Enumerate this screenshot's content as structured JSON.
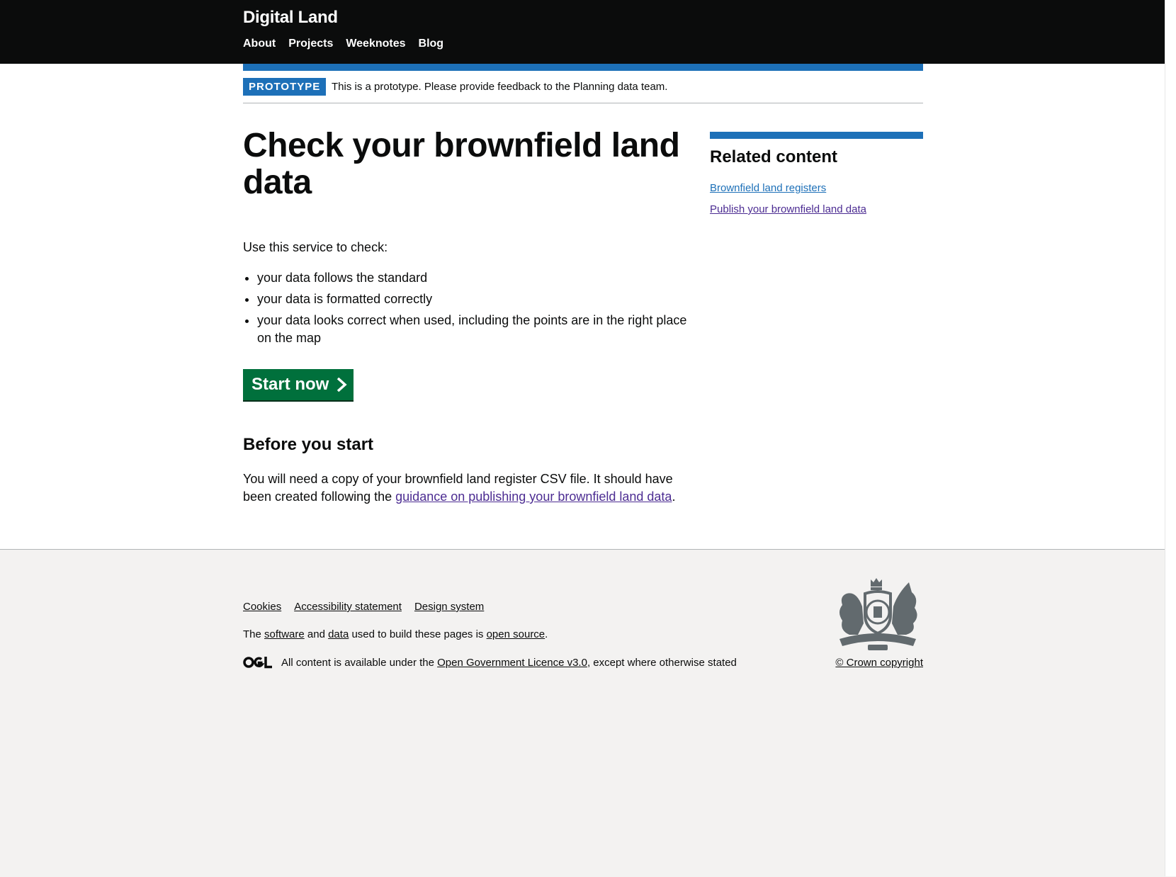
{
  "header": {
    "brand": "Digital Land",
    "nav": [
      "About",
      "Projects",
      "Weeknotes",
      "Blog"
    ]
  },
  "phase_banner": {
    "tag": "PROTOTYPE",
    "text": "This is a prototype. Please provide feedback to the Planning data team."
  },
  "main": {
    "title": "Check your brownfield land data",
    "lede": "Use this service to check:",
    "checks": [
      "your data follows the standard",
      "your data is formatted correctly",
      "your data looks correct when used, including the points are in the right place on the map"
    ],
    "start_button": "Start now",
    "before_heading": "Before you start",
    "before_text_1": "You will need a copy of your brownfield land register CSV file. It should have been created following the ",
    "before_link": "guidance on publishing your brownfield land data",
    "before_text_2": "."
  },
  "sidebar": {
    "heading": "Related content",
    "links": [
      "Brownfield land registers",
      "Publish your brownfield land data"
    ]
  },
  "footer": {
    "links": [
      "Cookies",
      "Accessibility statement",
      "Design system"
    ],
    "source_line": {
      "p1": "The ",
      "software": "software",
      "p2": " and ",
      "data": "data",
      "p3": " used to build these pages is ",
      "open_source": "open source",
      "p4": "."
    },
    "licence_line": {
      "p1": "All content is available under the ",
      "licence": "Open Government Licence v3.0",
      "p2": ", except where otherwise stated"
    },
    "crown_copyright": "© Crown copyright",
    "icons": [
      "ogl-logo-icon",
      "royal-coat-of-arms-icon"
    ]
  },
  "colors": {
    "header_bg": "#0b0c0c",
    "brand_blue": "#1d70b8",
    "start_green": "#00703c",
    "visited_link": "#4c2c92",
    "footer_bg": "#f3f2f1"
  }
}
